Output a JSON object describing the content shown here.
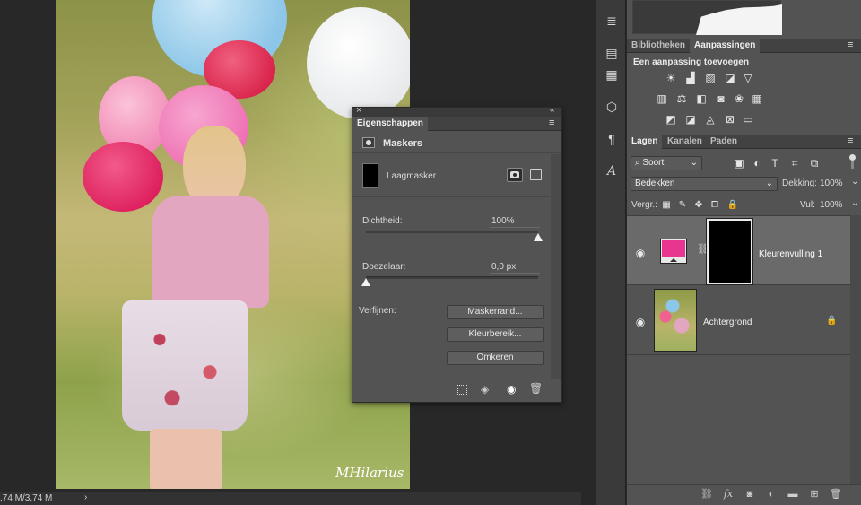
{
  "status": {
    "doc_size": ",74 M/3,74 M",
    "arrow": "›"
  },
  "watermark": "MHilarius",
  "properties": {
    "close": "×",
    "collapse": "‹‹",
    "title": "Eigenschappen",
    "menu": "≡",
    "section_title": "Maskers",
    "mask_label": "Laagmasker",
    "density_label": "Dichtheid:",
    "density_value": "100%",
    "density_fraction": 1.0,
    "feather_label": "Doezelaar:",
    "feather_value": "0,0 px",
    "feather_fraction": 0.0,
    "refine_label": "Verfijnen:",
    "buttons": {
      "mask_edge": "Maskerrand...",
      "color_range": "Kleurbereik...",
      "invert": "Omkeren"
    }
  },
  "adjustments_panel": {
    "tabs": [
      "Bibliotheken",
      "Aanpassingen"
    ],
    "active_tab": "Aanpassingen",
    "heading": "Een aanpassing toevoegen"
  },
  "layers_panel": {
    "tabs": [
      "Lagen",
      "Kanalen",
      "Paden"
    ],
    "active_tab": "Lagen",
    "filter_label": "Soort",
    "blend_mode": "Bedekken",
    "opacity_label": "Dekking:",
    "opacity_value": "100%",
    "lock_label": "Vergr.:",
    "fill_label": "Vul:",
    "fill_value": "100%",
    "layers": [
      {
        "name": "Kleurenvulling 1",
        "selected": true,
        "fill_color": "#e8358f"
      },
      {
        "name": "Achtergrond",
        "selected": false,
        "locked": true
      }
    ]
  },
  "colors": {
    "panel": "#535353",
    "selected_layer": "#6a6a6a",
    "accent_fill": "#e8358f"
  }
}
